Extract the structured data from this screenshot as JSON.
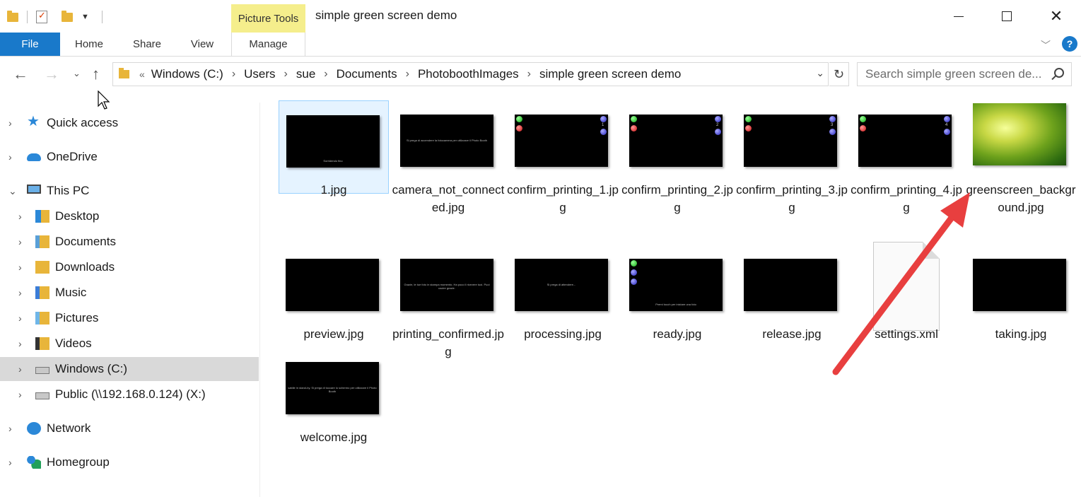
{
  "window": {
    "title": "simple green screen demo",
    "contextual_tab_group": "Picture Tools",
    "minimize": "",
    "maximize": "",
    "close": "✕"
  },
  "ribbon": {
    "tabs": [
      {
        "label": "File"
      },
      {
        "label": "Home"
      },
      {
        "label": "Share"
      },
      {
        "label": "View"
      },
      {
        "label": "Manage"
      }
    ],
    "help": "?"
  },
  "address": {
    "overflow": "«",
    "breadcrumbs": [
      "Windows (C:)",
      "Users",
      "sue",
      "Documents",
      "PhotoboothImages",
      "simple green screen demo"
    ],
    "separator": "›"
  },
  "search": {
    "placeholder": "Search simple green screen de..."
  },
  "nav_pane": {
    "items": [
      {
        "label": "Quick access",
        "icon": "star-icon",
        "expanded": false
      },
      {
        "label": "OneDrive",
        "icon": "cloud-icon",
        "expanded": false
      },
      {
        "label": "This PC",
        "icon": "computer-icon",
        "expanded": true
      },
      {
        "label": "Desktop",
        "icon": "desktop-folder-icon"
      },
      {
        "label": "Documents",
        "icon": "documents-folder-icon"
      },
      {
        "label": "Downloads",
        "icon": "downloads-folder-icon"
      },
      {
        "label": "Music",
        "icon": "music-folder-icon"
      },
      {
        "label": "Pictures",
        "icon": "pictures-folder-icon"
      },
      {
        "label": "Videos",
        "icon": "videos-folder-icon"
      },
      {
        "label": "Windows (C:)",
        "icon": "drive-icon",
        "selected": true
      },
      {
        "label": "Public (\\\\192.168.0.124) (X:)",
        "icon": "network-drive-icon"
      },
      {
        "label": "Network",
        "icon": "network-icon",
        "expanded": false
      },
      {
        "label": "Homegroup",
        "icon": "homegroup-icon",
        "expanded": false
      }
    ]
  },
  "files": [
    {
      "name": "1.jpg",
      "kind": "image",
      "selected": true,
      "caption": "Sorridendo fino"
    },
    {
      "name": "camera_not_connected.jpg",
      "kind": "image",
      "caption": "Si prega di accendere la fotocamera per utilizzare il Photo Booth"
    },
    {
      "name": "confirm_printing_1.jpg",
      "kind": "image",
      "number": "1"
    },
    {
      "name": "confirm_printing_2.jpg",
      "kind": "image",
      "number": "2"
    },
    {
      "name": "confirm_printing_3.jpg",
      "kind": "image",
      "number": "3"
    },
    {
      "name": "confirm_printing_4.jpg",
      "kind": "image",
      "number": "4"
    },
    {
      "name": "greenscreen_background.jpg",
      "kind": "image-green"
    },
    {
      "name": "preview.jpg",
      "kind": "image"
    },
    {
      "name": "printing_confirmed.jpg",
      "kind": "image",
      "caption": "Grazie, le tue foto in stampa momento. Ha poco il ricevere tuoi. Puoi uscire grazie."
    },
    {
      "name": "processing.jpg",
      "kind": "image",
      "caption": "Si prega di attendere..."
    },
    {
      "name": "ready.jpg",
      "kind": "image",
      "caption": "Premi touch per iniziare una foto"
    },
    {
      "name": "release.jpg",
      "kind": "image"
    },
    {
      "name": "settings.xml",
      "kind": "xml"
    },
    {
      "name": "taking.jpg",
      "kind": "image"
    },
    {
      "name": "welcome.jpg",
      "kind": "image",
      "caption": "sabile in stand-by. Si prega di toccare lo schermo per utilizzare il Photo Booth"
    }
  ],
  "colors": {
    "accent": "#1979ca",
    "contextual_tab": "#f5ee8c",
    "selection": "#e5f3ff",
    "selection_border": "#99d1ff",
    "nav_selected": "#d9d9d9",
    "annotation_arrow": "#e83f3f"
  }
}
